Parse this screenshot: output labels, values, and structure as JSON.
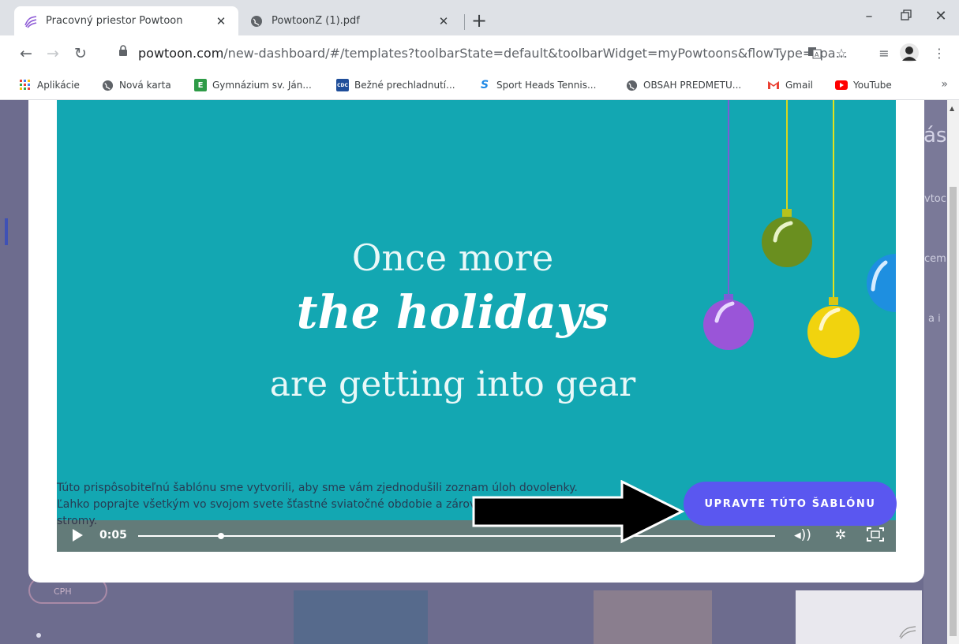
{
  "browser": {
    "tabs": [
      {
        "label": "Pracovný priestor Powtoon",
        "active": true,
        "icon": "powtoon-logo-icon"
      },
      {
        "label": "PowtoonZ (1).pdf",
        "active": false,
        "icon": "globe-icon"
      }
    ],
    "url_host": "powtoon.com",
    "url_path": "/new-dashboard/#/templates?toolbarState=default&toolbarWidget=myPowtoons&flowType=spa...",
    "bookmarks": [
      {
        "label": "Aplikácie",
        "icon": "apps-grid-icon"
      },
      {
        "label": "Nová karta",
        "icon": "globe-icon"
      },
      {
        "label": "Gymnázium sv. Ján...",
        "icon": "e-logo-icon"
      },
      {
        "label": "Bežné prechladnutí...",
        "icon": "cdc-logo-icon"
      },
      {
        "label": "Sport Heads Tennis...",
        "icon": "s-logo-icon"
      },
      {
        "label": "OBSAH PREDMETU...",
        "icon": "globe-icon"
      },
      {
        "label": "Gmail",
        "icon": "gmail-icon"
      },
      {
        "label": "YouTube",
        "icon": "youtube-icon"
      }
    ],
    "bookmarks_more": "»"
  },
  "video": {
    "line1": "Once more",
    "line2": "the holidays",
    "line3": "are getting into gear",
    "time": "0:05",
    "progress": 0.13
  },
  "page": {
    "description": "Túto prispôsobiteľnú šablónu sme vytvorili, aby sme vám zjednodušili zoznam úloh dovolenky. Ľahko poprajte všetkým vo svojom svete šťastné sviatočné obdobie a zároveň ušetrite peniaze a stromy.",
    "cta_label": "UPRAVTE TÚTO ŠABLÓNU",
    "bg_letter": "ás",
    "bg_snippets": [
      "vtoc",
      "cem",
      "a i"
    ],
    "pill": "CPH"
  }
}
